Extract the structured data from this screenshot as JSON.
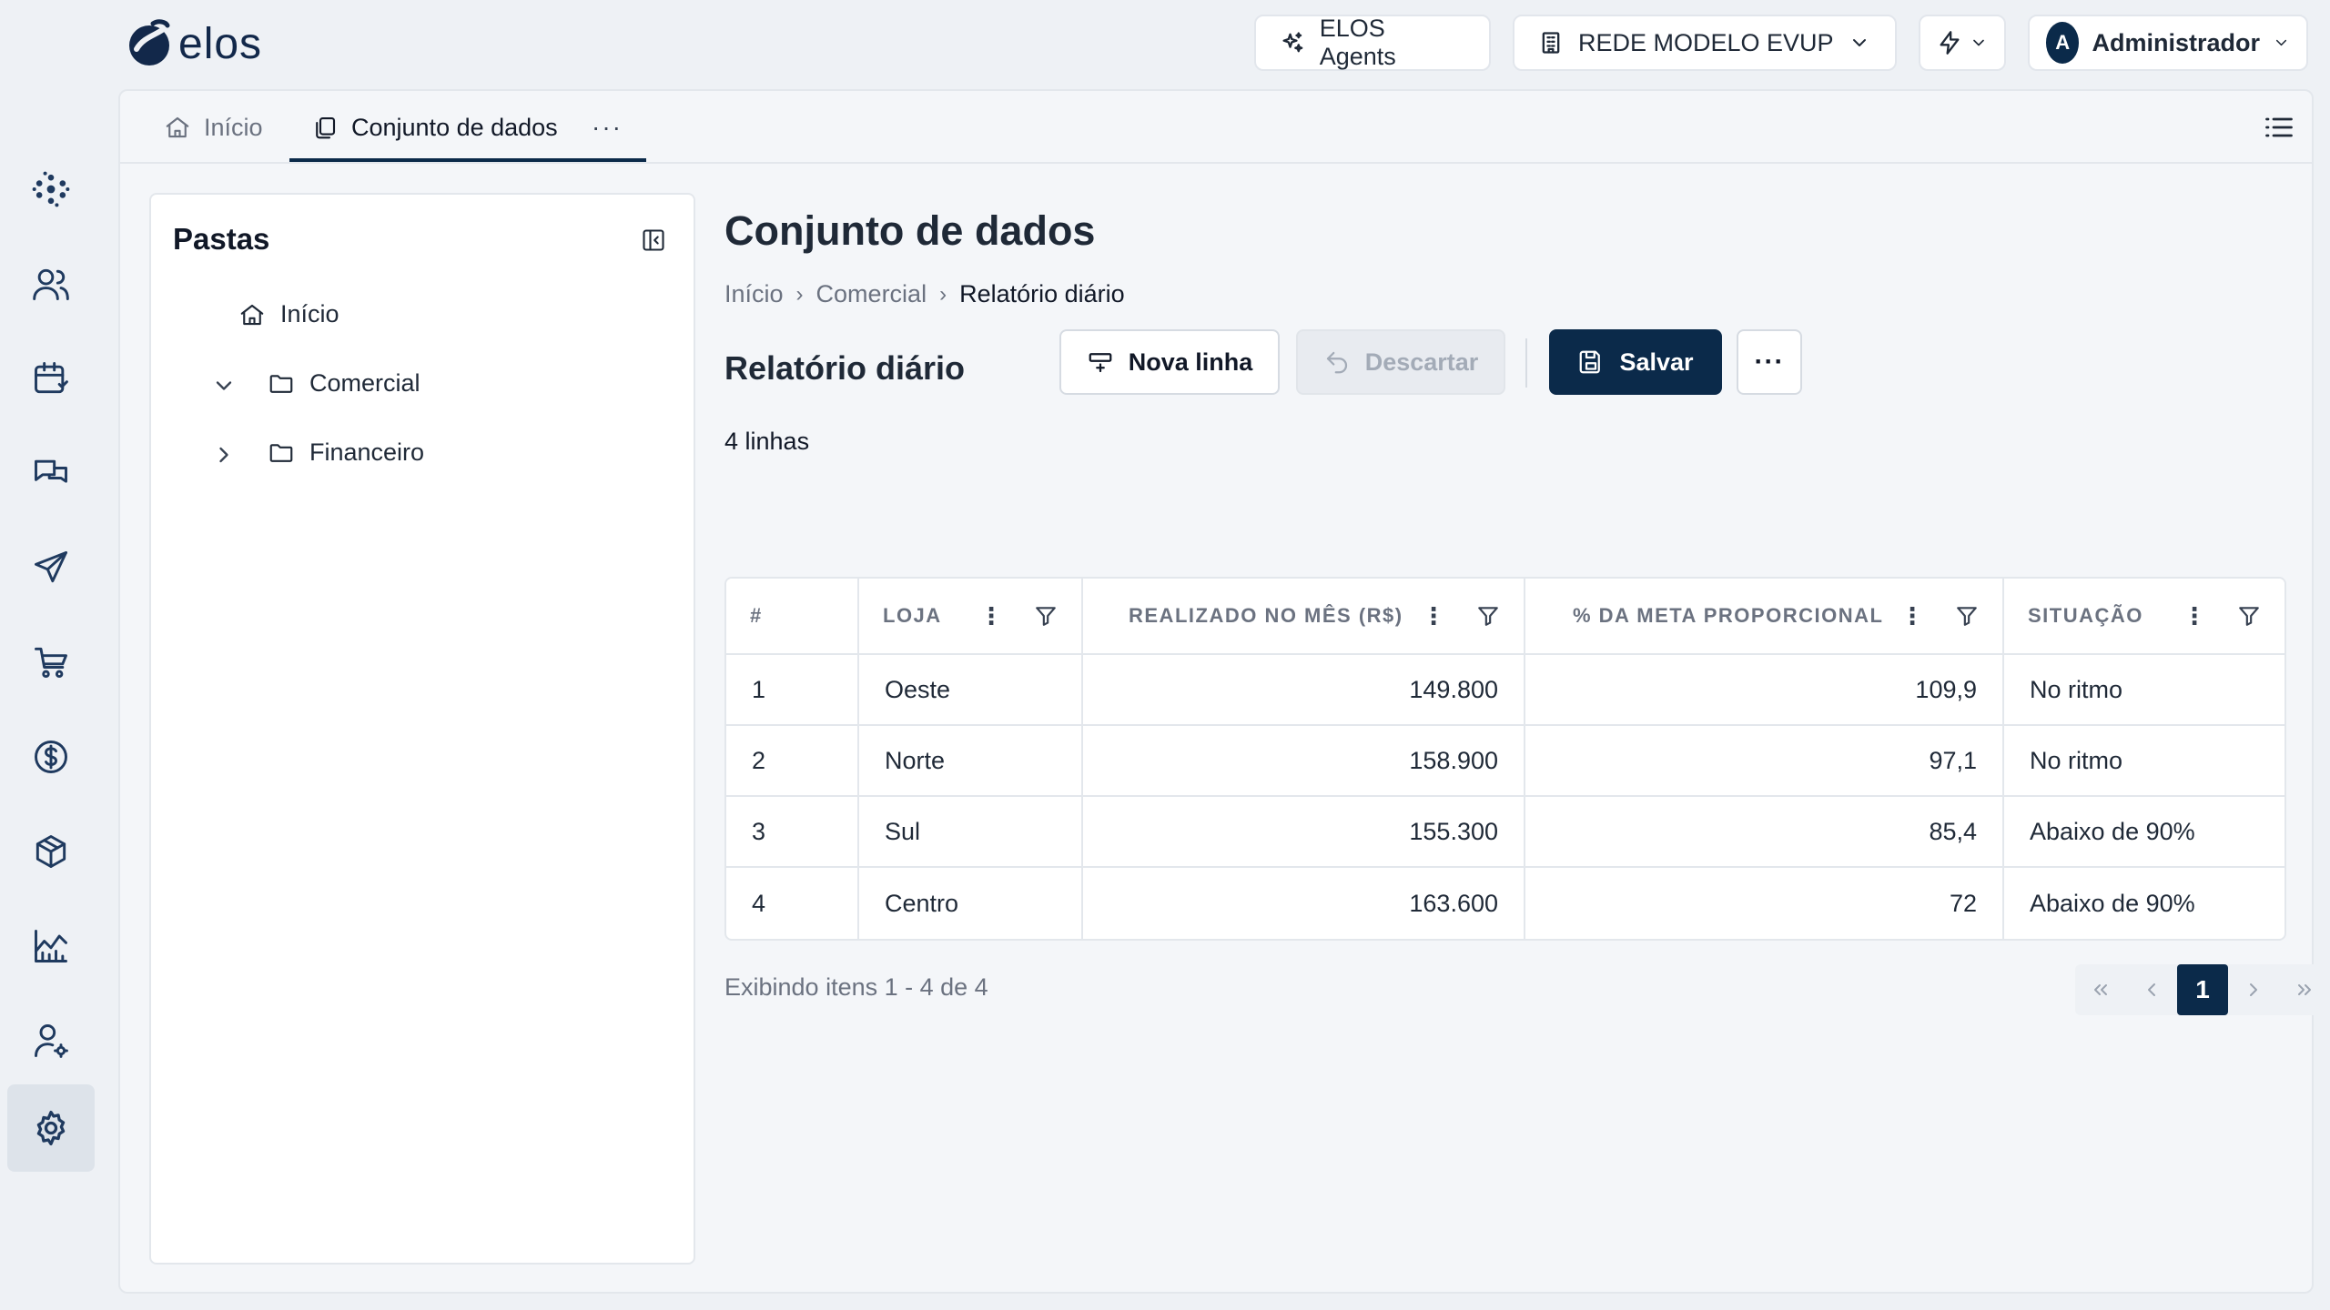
{
  "brand": {
    "name": "elos"
  },
  "header": {
    "agents_label": "ELOS Agents",
    "network_label": "REDE MODELO EVUP",
    "user": {
      "initial": "A",
      "name": "Administrador"
    }
  },
  "rail": {
    "items": [
      "dashboard-icon",
      "users-icon",
      "calendar-icon",
      "chat-icon",
      "send-icon",
      "cart-icon",
      "dollar-icon",
      "box-icon",
      "chart-icon",
      "user-settings-icon",
      "settings-icon"
    ],
    "active": "settings-icon"
  },
  "tabs": [
    {
      "label": "Início"
    },
    {
      "label": "Conjunto de dados",
      "active": true
    }
  ],
  "tab_more": "···",
  "folders": {
    "title": "Pastas",
    "items": [
      {
        "label": "Início"
      },
      {
        "label": "Comercial",
        "expanded": true
      },
      {
        "label": "Financeiro",
        "expanded": false
      }
    ]
  },
  "page": {
    "title": "Conjunto de dados",
    "breadcrumb": [
      "Início",
      "Comercial",
      "Relatório diário"
    ],
    "section_title": "Relatório diário",
    "row_count": "4 linhas"
  },
  "actions": {
    "new_row": "Nova linha",
    "discard": "Descartar",
    "save": "Salvar",
    "more": "···"
  },
  "table": {
    "columns": [
      "#",
      "LOJA",
      "REALIZADO NO MÊS (R$)",
      "% DA META PROPORCIONAL",
      "SITUAÇÃO"
    ],
    "rows": [
      [
        "1",
        "Oeste",
        "149.800",
        "109,9",
        "No ritmo"
      ],
      [
        "2",
        "Norte",
        "158.900",
        "97,1",
        "No ritmo"
      ],
      [
        "3",
        "Sul",
        "155.300",
        "85,4",
        "Abaixo de 90%"
      ],
      [
        "4",
        "Centro",
        "163.600",
        "72",
        "Abaixo de 90%"
      ]
    ]
  },
  "footer": {
    "showing": "Exibindo itens 1 - 4 de 4",
    "current_page": "1"
  },
  "colors": {
    "accent": "#0b2a4a",
    "background": "#eef1f5",
    "panel": "#ffffff"
  }
}
